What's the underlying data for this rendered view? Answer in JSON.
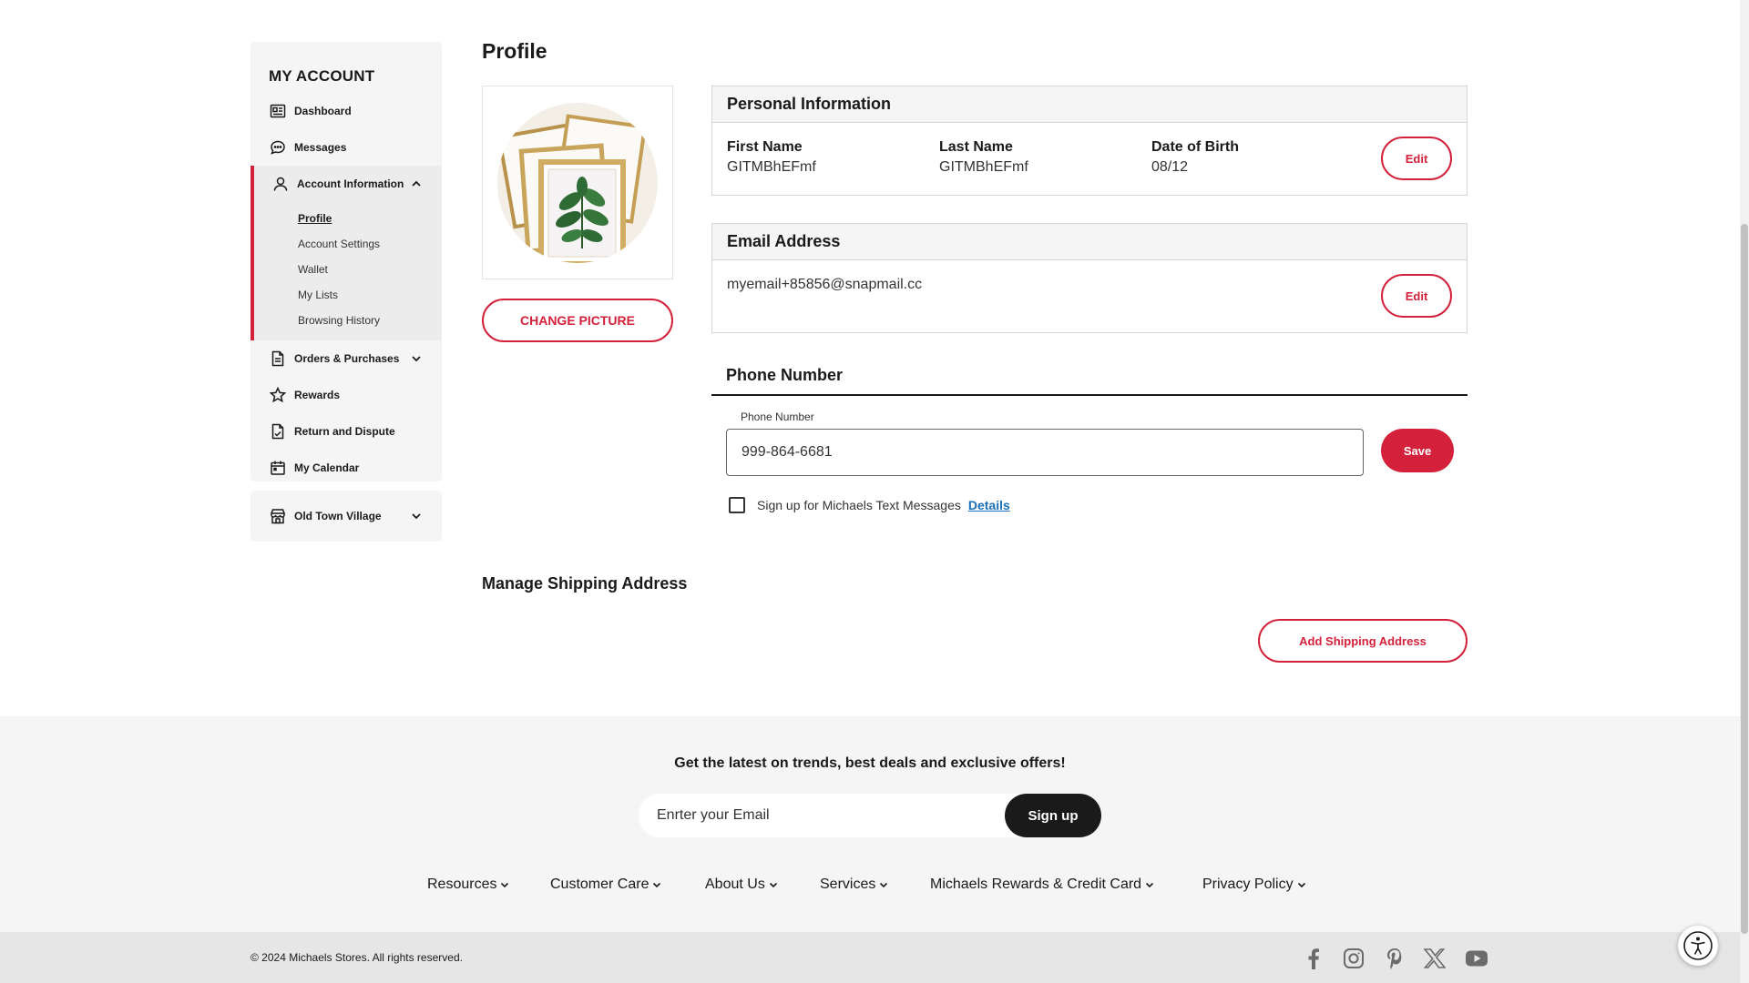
{
  "sidebar": {
    "title": "MY ACCOUNT",
    "items": [
      {
        "label": "Dashboard",
        "icon": "dashboard-icon"
      },
      {
        "label": "Messages",
        "icon": "message-icon"
      }
    ],
    "account_info": {
      "label": "Account Information",
      "sub": [
        "Profile",
        "Account Settings",
        "Wallet",
        "My Lists",
        "Browsing History"
      ],
      "active": "Profile"
    },
    "items_after": [
      {
        "label": "Orders & Purchases",
        "icon": "receipt-icon"
      },
      {
        "label": "Rewards",
        "icon": "star-icon"
      },
      {
        "label": "Return and Dispute",
        "icon": "return-doc-icon"
      },
      {
        "label": "My Calendar",
        "icon": "calendar-icon"
      }
    ],
    "store": {
      "label": "Old Town Village",
      "icon": "store-icon"
    }
  },
  "main": {
    "title": "Profile",
    "change_picture": "CHANGE PICTURE",
    "personal": {
      "heading": "Personal Information",
      "first_name_label": "First Name",
      "first_name": "GITMBhEFmf",
      "last_name_label": "Last Name",
      "last_name": "GITMBhEFmf",
      "dob_label": "Date of Birth",
      "dob": "08/12",
      "edit": "Edit"
    },
    "email": {
      "heading": "Email Address",
      "value": "myemail+85856@snapmail.cc",
      "edit": "Edit"
    },
    "phone": {
      "heading": "Phone Number",
      "field_label": "Phone Number",
      "value": "999-864-6681",
      "save": "Save",
      "sms_label": "Sign up for Michaels Text Messages",
      "details": "Details",
      "sms_checked": false
    },
    "shipping": {
      "heading": "Manage Shipping Address",
      "add": "Add Shipping Address"
    }
  },
  "footer": {
    "promo": "Get the latest on trends, best deals and exclusive offers!",
    "email_placeholder": "Enrter your Email",
    "signup": "Sign up",
    "links": [
      "Resources",
      "Customer Care",
      "About Us",
      "Services",
      "Michaels Rewards & Credit Card",
      "Privacy Policy"
    ],
    "copyright": "© 2024 Michaels Stores. All rights reserved.",
    "social": [
      "facebook-icon",
      "instagram-icon",
      "pinterest-icon",
      "x-icon",
      "youtube-icon"
    ]
  },
  "colors": {
    "brand_red": "#d3213b",
    "link_blue": "#1a6fb8",
    "dark": "#1a1a1a"
  }
}
